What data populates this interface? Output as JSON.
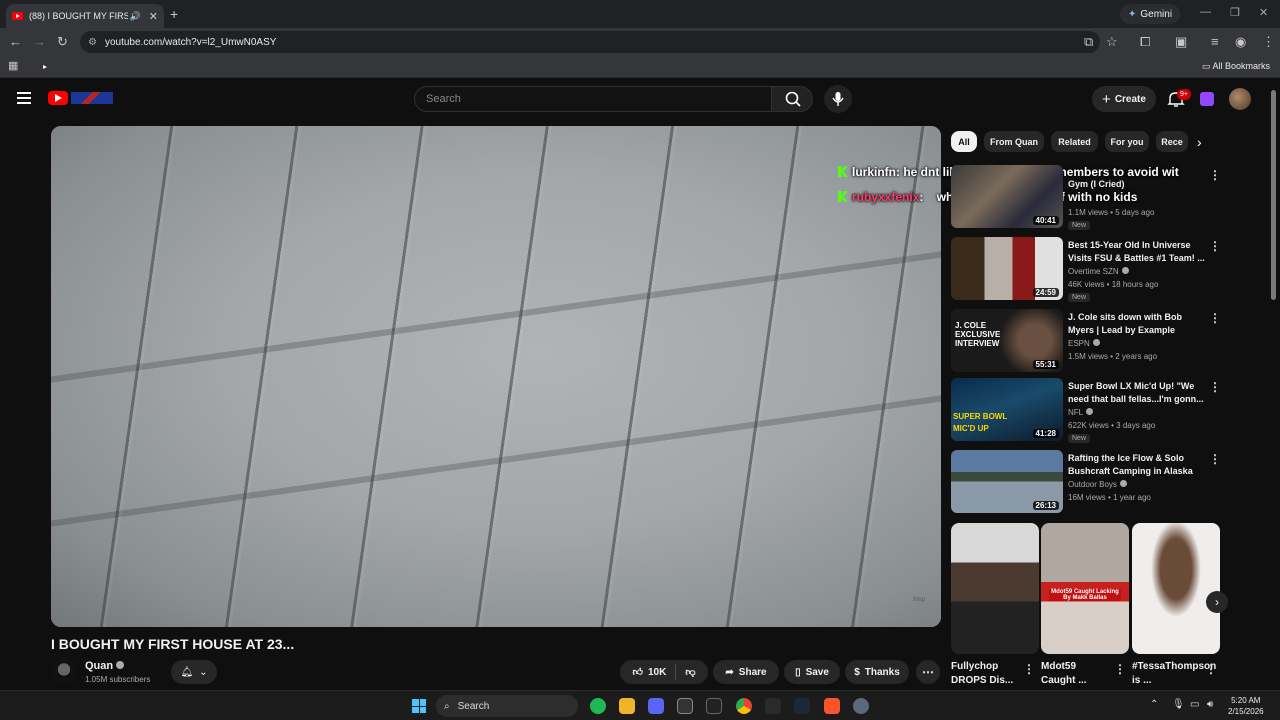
{
  "browser": {
    "tab_title": "(88) I BOUGHT MY FIRST HOUSE",
    "url": "youtube.com/watch?v=l2_UmwN0ASY",
    "gemini_label": "Gemini",
    "all_bookmarks": "All Bookmarks"
  },
  "header": {
    "search_placeholder": "Search",
    "create_label": "Create",
    "notif_badge": "9+"
  },
  "video": {
    "title": "I BOUGHT MY FIRST HOUSE AT 23...",
    "channel": "Quan",
    "subscribers": "1.05M subscribers",
    "likes": "10K",
    "share_label": "Share",
    "save_label": "Save",
    "thanks_label": "Thanks",
    "watermark": "Xmp"
  },
  "chips": [
    "All",
    "From Quan",
    "Related",
    "For you",
    "Rece"
  ],
  "chat": [
    {
      "user": "lurkinfn",
      "text": "he dnt like showing family members to avoid wit",
      "user_color": "#ffffff"
    },
    {
      "user": "rubyxxfenix",
      "text": "who wanna be rich asf with no kids",
      "user_color": "#ff3b6b"
    }
  ],
  "recommendations": [
    {
      "title": "Gym (I Cried)",
      "channel": "",
      "meta": "1.1M views • 5 days ago",
      "duration": "40:41",
      "new": "New"
    },
    {
      "title": "Best 15-Year Old In Universe Visits FSU & Battles #1 Team! ...",
      "channel": "Overtime SZN",
      "meta": "46K views • 18 hours ago",
      "duration": "24:59",
      "new": "New"
    },
    {
      "title": "J. Cole sits down with Bob Myers | Lead by Example",
      "channel": "ESPN",
      "meta": "1.5M views • 2 years ago",
      "duration": "55:31",
      "new": "",
      "thumb_text": "J. COLE EXCLUSIVE INTERVIEW"
    },
    {
      "title": "Super Bowl LX Mic'd Up! \"We need that ball fellas...I'm gonn...",
      "channel": "NFL",
      "meta": "622K views • 3 days ago",
      "duration": "41:28",
      "new": "New",
      "thumb_text": "SUPER BOWL MIC'D UP"
    },
    {
      "title": "Rafting the Ice Flow & Solo Bushcraft Camping in Alaska",
      "channel": "Outdoor Boys",
      "meta": "16M views • 1 year ago",
      "duration": "26:13",
      "new": ""
    }
  ],
  "shorts": [
    {
      "title": "Fullychop DROPS Dis..."
    },
    {
      "title": "Mdot59 Caught ...",
      "thumb_text": "Mdot59 Caught Lacking By Makk Ballas"
    },
    {
      "title": "#TessaThompson is ..."
    }
  ],
  "taskbar": {
    "search_label": "Search",
    "time": "5:20 AM",
    "date": "2/15/2026"
  }
}
